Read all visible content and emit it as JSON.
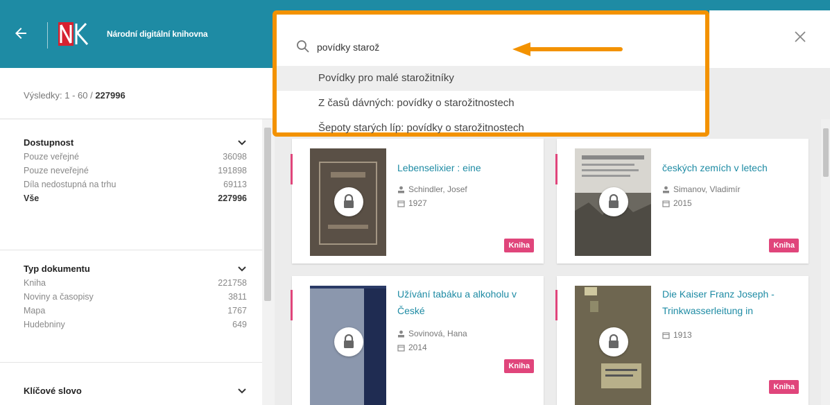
{
  "header": {
    "title": "Národní digitální knihovna",
    "logo_text": "NK",
    "colors": {
      "bar": "#1e8ba4",
      "accent": "#f39200",
      "badge": "#e0457b"
    }
  },
  "search": {
    "value": "povídky starož",
    "suggestions": [
      "Povídky pro malé starožitníky",
      "Z časů dávných: povídky o starožitnostech",
      "Šepoty starých líp: povídky o starožitnostech"
    ]
  },
  "results": {
    "prefix": "Výsledky: 1 - 60 / ",
    "total": "227996"
  },
  "facets": {
    "access": {
      "title": "Dostupnost",
      "items": [
        {
          "label": "Pouze veřejné",
          "count": "36098"
        },
        {
          "label": "Pouze neveřejné",
          "count": "191898"
        },
        {
          "label": "Díla nedostupná na trhu",
          "count": "69113"
        },
        {
          "label": "Vše",
          "count": "227996"
        }
      ]
    },
    "doctype": {
      "title": "Typ dokumentu",
      "items": [
        {
          "label": "Kniha",
          "count": "221758"
        },
        {
          "label": "Noviny a časopisy",
          "count": "3811"
        },
        {
          "label": "Mapa",
          "count": "1767"
        },
        {
          "label": "Hudebniny",
          "count": "649"
        }
      ]
    },
    "keyword": {
      "title": "Klíčové slovo"
    }
  },
  "cards": [
    {
      "title": "Lebenselixier : eine",
      "author": "Schindler, Josef",
      "year": "1927",
      "type": "Kniha"
    },
    {
      "title": "českých zemích v letech",
      "author": "Simanov, Vladimír",
      "year": "2015",
      "type": "Kniha"
    },
    {
      "title": "Užívání tabáku a alkoholu v České",
      "author": "Sovinová, Hana",
      "year": "2014",
      "type": "Kniha"
    },
    {
      "title": "Die Kaiser Franz Joseph - Trinkwasserleitung in",
      "year": "1913",
      "type": "Kniha"
    }
  ]
}
